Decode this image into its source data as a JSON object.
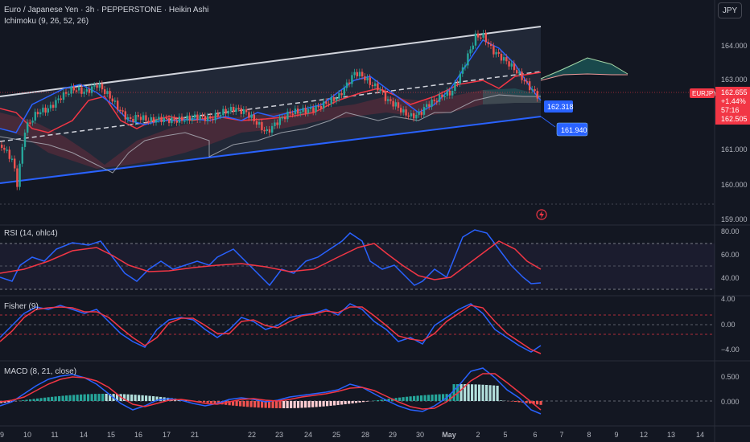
{
  "header": {
    "symbol_title": "Euro / Japanese Yen · 3h · PEPPERSTONE · Heikin Ashi",
    "indicator_main": "Ichimoku (9, 26, 52, 26)",
    "currency_button": "JPY"
  },
  "price_axis": {
    "ticks": [
      "164.000",
      "163.000",
      "161.000",
      "160.000",
      "159.000"
    ]
  },
  "price_labels": {
    "symbol_tag": "EURJPY",
    "last_price": "162.655",
    "change_pct": "+1.44%",
    "countdown": "57:16",
    "sub_price": "162.505",
    "channel_mid_value": "162.318",
    "channel_low_value": "161.940"
  },
  "panes": {
    "rsi": {
      "title": "RSI (14, ohlc4)",
      "ticks": [
        "80.00",
        "60.00",
        "40.00"
      ]
    },
    "fisher": {
      "title": "Fisher (9)",
      "ticks": [
        "4.00",
        "0.00",
        "−4.00"
      ]
    },
    "macd": {
      "title": "MACD (8, 21, close)",
      "ticks": [
        "0.500",
        "0.000"
      ]
    }
  },
  "time_axis": {
    "labels": [
      "9",
      "10",
      "11",
      "14",
      "15",
      "16",
      "17",
      "21",
      "22",
      "23",
      "24",
      "25",
      "28",
      "29",
      "30",
      "May",
      "2",
      "5",
      "6",
      "7",
      "8",
      "9",
      "12",
      "13",
      "14"
    ]
  },
  "colors": {
    "background": "#131722",
    "bull": "#26a69a",
    "bear": "#ef5350",
    "blue_line": "#2962ff",
    "accent_label": "#2962ff",
    "price_tag": "#f23645"
  },
  "icons": {
    "alert": "lightning-alert-icon"
  }
}
